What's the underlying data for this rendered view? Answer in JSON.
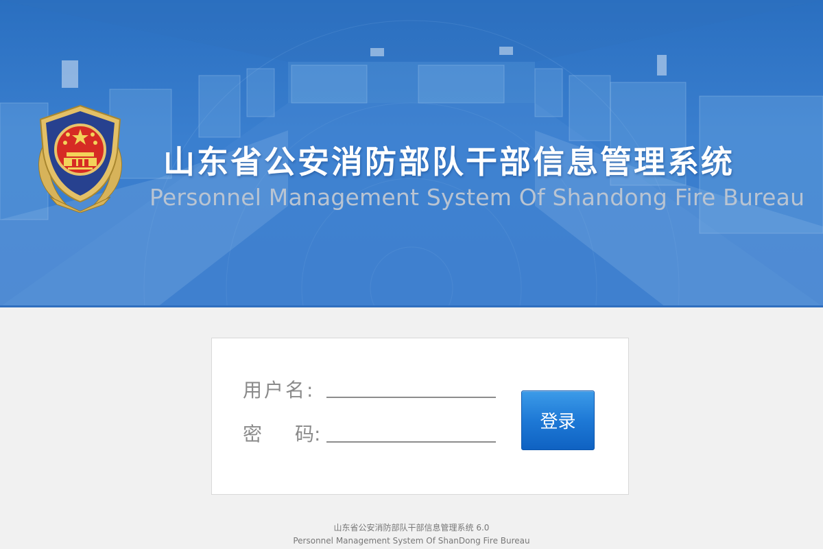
{
  "header": {
    "title_cn": "山东省公安消防部队干部信息管理系统",
    "title_en": "Personnel Management System Of Shandong Fire Bureau",
    "emblem_icon": "police-emblem-icon",
    "colors": {
      "banner": "#3a7bcc",
      "title": "#ffffff",
      "subtitle": "#b9c4d2"
    }
  },
  "login": {
    "username_label": "用户名:",
    "password_label_1": "密",
    "password_label_2": "码:",
    "username_value": "",
    "password_value": "",
    "submit_label": "登录",
    "colors": {
      "button": "#1e79d6"
    }
  },
  "footer": {
    "line1": "山东省公安消防部队干部信息管理系统 6.0",
    "line2": "Personnel Management System Of ShanDong Fire Bureau"
  }
}
